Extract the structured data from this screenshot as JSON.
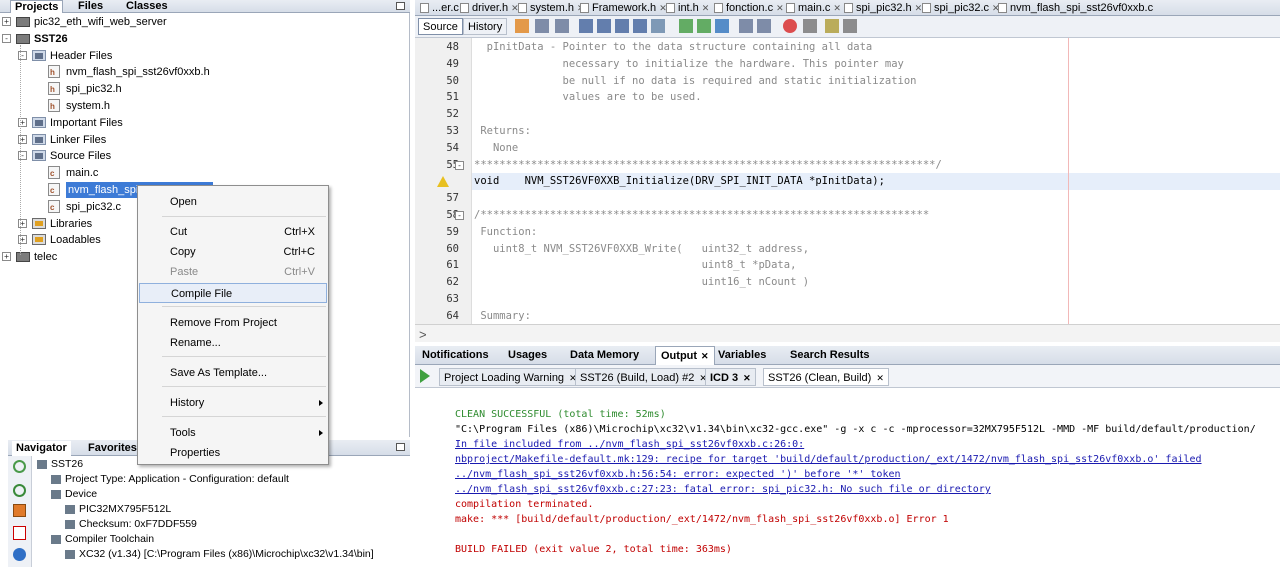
{
  "projects_panel": {
    "tabs": [
      "Projects",
      "Files",
      "Classes"
    ],
    "tree": [
      {
        "label": "pic32_eth_wifi_web_server",
        "level": 0,
        "icon": "project-icon",
        "expander": "+"
      },
      {
        "label": "SST26",
        "level": 0,
        "icon": "project-icon",
        "expander": "-",
        "bold": true
      },
      {
        "label": "Header Files",
        "level": 1,
        "icon": "folder-icon",
        "expander": "-"
      },
      {
        "label": "nvm_flash_spi_sst26vf0xxb.h",
        "level": 2,
        "icon": "header-file-icon"
      },
      {
        "label": "spi_pic32.h",
        "level": 2,
        "icon": "header-file-icon"
      },
      {
        "label": "system.h",
        "level": 2,
        "icon": "header-file-icon"
      },
      {
        "label": "Important Files",
        "level": 1,
        "icon": "folder-icon",
        "expander": "+"
      },
      {
        "label": "Linker Files",
        "level": 1,
        "icon": "folder-icon",
        "expander": "+"
      },
      {
        "label": "Source Files",
        "level": 1,
        "icon": "folder-icon",
        "expander": "-"
      },
      {
        "label": "main.c",
        "level": 2,
        "icon": "c-file-icon"
      },
      {
        "label": "nvm_flash_spi_sst26vf0xxb.c",
        "level": 2,
        "icon": "c-file-icon",
        "selected": true
      },
      {
        "label": "spi_pic32.c",
        "level": 2,
        "icon": "c-file-icon"
      },
      {
        "label": "Libraries",
        "level": 1,
        "icon": "folder-icon",
        "expander": "+"
      },
      {
        "label": "Loadables",
        "level": 1,
        "icon": "folder-icon",
        "expander": "+"
      },
      {
        "label": "telec",
        "level": 0,
        "icon": "project-icon",
        "expander": "+"
      }
    ]
  },
  "context_menu": {
    "items": [
      {
        "label": "Open",
        "shortcut": ""
      },
      {
        "label": "Cut",
        "shortcut": "Ctrl+X"
      },
      {
        "label": "Copy",
        "shortcut": "Ctrl+C"
      },
      {
        "label": "Paste",
        "shortcut": "Ctrl+V",
        "disabled": true
      },
      {
        "label": "Compile File",
        "shortcut": "",
        "highlighted": true
      },
      {
        "label": "Remove From Project",
        "shortcut": ""
      },
      {
        "label": "Rename...",
        "shortcut": ""
      },
      {
        "label": "Save As Template...",
        "shortcut": ""
      },
      {
        "label": "History",
        "shortcut": "",
        "submenu": true
      },
      {
        "label": "Tools",
        "shortcut": "",
        "submenu": true
      },
      {
        "label": "Properties",
        "shortcut": ""
      }
    ]
  },
  "navigator": {
    "tabs": [
      "Navigator",
      "Favorites"
    ],
    "rows": [
      {
        "label": "SST26",
        "level": 0
      },
      {
        "label": "Project Type: Application - Configuration: default",
        "level": 1
      },
      {
        "label": "Device",
        "level": 1
      },
      {
        "label": "PIC32MX795F512L",
        "level": 2
      },
      {
        "label": "Checksum: 0xF7DDF559",
        "level": 2
      },
      {
        "label": "Compiler Toolchain",
        "level": 1
      },
      {
        "label": "XC32 (v1.34) [C:\\Program Files (x86)\\Microchip\\xc32\\v1.34\\bin]",
        "level": 2
      }
    ]
  },
  "editor": {
    "file_tabs": [
      "...er.c",
      "driver.h",
      "system.h",
      "Framework.h",
      "int.h",
      "fonction.c",
      "main.c",
      "spi_pic32.h",
      "spi_pic32.c",
      "nvm_flash_spi_sst26vf0xxb.c"
    ],
    "source_label": "Source",
    "history_label": "History",
    "lines": [
      {
        "num": "48",
        "text": "  pInitData - Pointer to the data structure containing all data"
      },
      {
        "num": "49",
        "text": "              necessary to initialize the hardware. This pointer may"
      },
      {
        "num": "50",
        "text": "              be null if no data is required and static initialization"
      },
      {
        "num": "51",
        "text": "              values are to be used."
      },
      {
        "num": "52",
        "text": ""
      },
      {
        "num": "53",
        "text": " Returns:"
      },
      {
        "num": "54",
        "text": "   None"
      },
      {
        "num": "55",
        "text": "*************************************************************************/"
      },
      {
        "num": "",
        "text": "void    NVM_SST26VF0XXB_Initialize(DRV_SPI_INIT_DATA *pInitData);",
        "warning": true
      },
      {
        "num": "57",
        "text": ""
      },
      {
        "num": "58",
        "text": "/***********************************************************************"
      },
      {
        "num": "59",
        "text": " Function:"
      },
      {
        "num": "60",
        "text": "   uint8_t NVM_SST26VF0XXB_Write(   uint32_t address,"
      },
      {
        "num": "61",
        "text": "                                    uint8_t *pData,"
      },
      {
        "num": "62",
        "text": "                                    uint16_t nCount )"
      },
      {
        "num": "63",
        "text": ""
      },
      {
        "num": "64",
        "text": " Summary:"
      }
    ]
  },
  "output_panel": {
    "tabs": [
      "Notifications",
      "Usages",
      "Data Memory",
      "Output",
      "Variables",
      "Search Results"
    ],
    "subtabs": [
      "Project Loading Warning",
      "SST26 (Build, Load) #2",
      "ICD 3",
      "SST26 (Clean, Build)"
    ],
    "lines": [
      {
        "text": "CLEAN SUCCESSFUL (total time: 52ms)",
        "color": "#2e8b2e",
        "underline": false
      },
      {
        "text": "\"C:\\Program Files (x86)\\Microchip\\xc32\\v1.34\\bin\\xc32-gcc.exe\" -g -x c -c -mprocessor=32MX795F512L -MMD -MF build/default/production/",
        "color": "#000000",
        "underline": false
      },
      {
        "text": "In file included from ../nvm_flash_spi_sst26vf0xxb.c:26:0:",
        "color": "#1a1ab0",
        "underline": true
      },
      {
        "text": "nbproject/Makefile-default.mk:129: recipe for target 'build/default/production/_ext/1472/nvm_flash_spi_sst26vf0xxb.o' failed",
        "color": "#1a1ab0",
        "underline": true
      },
      {
        "text": "../nvm_flash_spi_sst26vf0xxb.h:56:54: error: expected ')' before '*' token",
        "color": "#1a1ab0",
        "underline": true
      },
      {
        "text": "../nvm_flash_spi_sst26vf0xxb.c:27:23: fatal error: spi_pic32.h: No such file or directory",
        "color": "#1a1ab0",
        "underline": true
      },
      {
        "text": "compilation terminated.",
        "color": "#c00000",
        "underline": false
      },
      {
        "text": "make: *** [build/default/production/_ext/1472/nvm_flash_spi_sst26vf0xxb.o] Error 1",
        "color": "#c00000",
        "underline": false
      },
      {
        "text": "",
        "color": "#000000",
        "underline": false
      },
      {
        "text": "BUILD FAILED (exit value 2, total time: 363ms)",
        "color": "#c00000",
        "underline": false
      }
    ]
  }
}
